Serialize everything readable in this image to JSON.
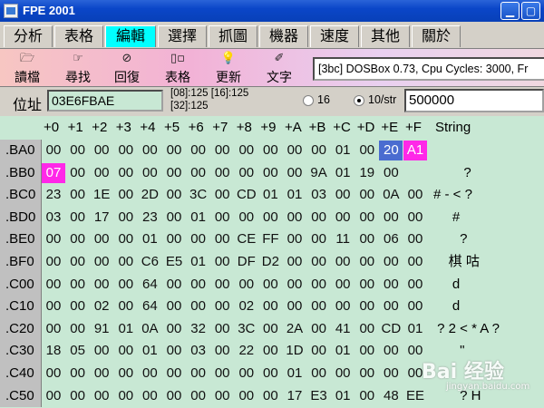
{
  "window": {
    "title": "FPE 2001"
  },
  "menu": {
    "tabs": [
      "分析",
      "表格",
      "編輯",
      "選擇",
      "抓圖",
      "機器",
      "速度",
      "其他",
      "關於"
    ],
    "active_index": 2
  },
  "toolbar": {
    "buttons": [
      {
        "label": "讀檔",
        "icon": "folder-open-icon"
      },
      {
        "label": "尋找",
        "icon": "search-pointer-icon"
      },
      {
        "label": "回復",
        "icon": "undo-icon"
      },
      {
        "label": "表格",
        "icon": "table-icon"
      },
      {
        "label": "更新",
        "icon": "refresh-bulb-icon"
      },
      {
        "label": "文字",
        "icon": "text-icon"
      }
    ],
    "status": "[3bc] DOSBox 0.73, Cpu Cycles:     3000, Fr"
  },
  "address": {
    "label": "位址",
    "value": "03E6FBAE",
    "info_line1": "[08]:125 [16]:125",
    "info_line2": "[32]:125",
    "radio_16": "16",
    "radio_10": "10/str",
    "selected_radio": "10/str",
    "search_value": "500000"
  },
  "grid": {
    "columns": [
      "+0",
      "+1",
      "+2",
      "+3",
      "+4",
      "+5",
      "+6",
      "+7",
      "+8",
      "+9",
      "+A",
      "+B",
      "+C",
      "+D",
      "+E",
      "+F"
    ],
    "string_header": "String",
    "rows": [
      {
        "addr": ".BA0",
        "bytes": [
          "00",
          "00",
          "00",
          "00",
          "00",
          "00",
          "00",
          "00",
          "00",
          "00",
          "00",
          "00",
          "01",
          "00",
          "20",
          "A1"
        ],
        "str": ""
      },
      {
        "addr": ".BB0",
        "bytes": [
          "07",
          "00",
          "00",
          "00",
          "00",
          "00",
          "00",
          "00",
          "00",
          "00",
          "00",
          "9A",
          "01",
          "19",
          "00",
          ""
        ],
        "str": "        ?"
      },
      {
        "addr": ".BC0",
        "bytes": [
          "23",
          "00",
          "1E",
          "00",
          "2D",
          "00",
          "3C",
          "00",
          "CD",
          "01",
          "01",
          "03",
          "00",
          "00",
          "0A",
          "00"
        ],
        "str": "# - < ?"
      },
      {
        "addr": ".BD0",
        "bytes": [
          "03",
          "00",
          "17",
          "00",
          "23",
          "00",
          "01",
          "00",
          "00",
          "00",
          "00",
          "00",
          "00",
          "00",
          "00",
          "00"
        ],
        "str": "     #"
      },
      {
        "addr": ".BE0",
        "bytes": [
          "00",
          "00",
          "00",
          "00",
          "01",
          "00",
          "00",
          "00",
          "CE",
          "FF",
          "00",
          "00",
          "11",
          "00",
          "06",
          "00"
        ],
        "str": "       ?"
      },
      {
        "addr": ".BF0",
        "bytes": [
          "00",
          "00",
          "00",
          "00",
          "C6",
          "E5",
          "01",
          "00",
          "DF",
          "D2",
          "00",
          "00",
          "00",
          "00",
          "00",
          "00"
        ],
        "str": "    棋 咕"
      },
      {
        "addr": ".C00",
        "bytes": [
          "00",
          "00",
          "00",
          "00",
          "64",
          "00",
          "00",
          "00",
          "00",
          "00",
          "00",
          "00",
          "00",
          "00",
          "00",
          "00"
        ],
        "str": "     d"
      },
      {
        "addr": ".C10",
        "bytes": [
          "00",
          "00",
          "02",
          "00",
          "64",
          "00",
          "00",
          "00",
          "02",
          "00",
          "00",
          "00",
          "00",
          "00",
          "00",
          "00"
        ],
        "str": "     d"
      },
      {
        "addr": ".C20",
        "bytes": [
          "00",
          "00",
          "91",
          "01",
          "0A",
          "00",
          "32",
          "00",
          "3C",
          "00",
          "2A",
          "00",
          "41",
          "00",
          "CD",
          "01"
        ],
        "str": " ? 2 < * A ?"
      },
      {
        "addr": ".C30",
        "bytes": [
          "18",
          "05",
          "00",
          "00",
          "01",
          "00",
          "03",
          "00",
          "22",
          "00",
          "1D",
          "00",
          "01",
          "00",
          "00",
          "00"
        ],
        "str": "       \""
      },
      {
        "addr": ".C40",
        "bytes": [
          "00",
          "00",
          "00",
          "00",
          "00",
          "00",
          "00",
          "00",
          "00",
          "00",
          "01",
          "00",
          "00",
          "00",
          "00",
          "00"
        ],
        "str": ""
      },
      {
        "addr": ".C50",
        "bytes": [
          "00",
          "00",
          "00",
          "00",
          "00",
          "00",
          "00",
          "00",
          "00",
          "00",
          "17",
          "E3",
          "01",
          "00",
          "48",
          "EE"
        ],
        "str": "       ? H"
      }
    ],
    "highlights": [
      {
        "row": 0,
        "col": 14,
        "color": "#4a6cd0"
      },
      {
        "row": 0,
        "col": 15,
        "color": "#ff28e8"
      },
      {
        "row": 1,
        "col": 0,
        "color": "#ff28e8"
      }
    ]
  },
  "colors": {
    "grid_bg": "#c8e8d4",
    "active_tab": "#00ffff",
    "highlight_magenta": "#ff28e8",
    "highlight_blue": "#4a6cd0"
  },
  "watermark": {
    "text": "Bai 经验",
    "sub": "jingyan.baidu.com"
  }
}
